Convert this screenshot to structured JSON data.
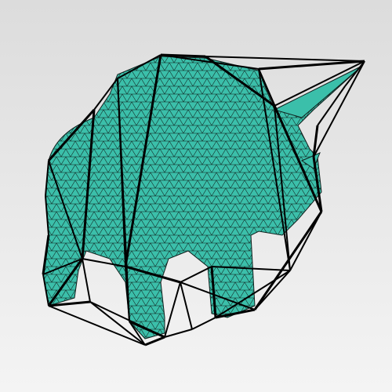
{
  "colors": {
    "background_top": "#dcdcdc",
    "background_bottom": "#f4f4f4",
    "mesh_fill": "#3bbfaa",
    "mesh_edges": "#0f1f1c",
    "hull_edges": "#000000"
  },
  "scene": {
    "subject": "triceratops",
    "layers": [
      "surface-mesh",
      "convex-hull-wireframe"
    ]
  }
}
